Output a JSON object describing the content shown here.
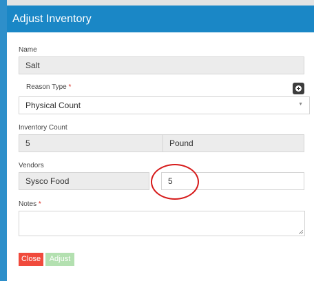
{
  "modal": {
    "title": "Adjust Inventory"
  },
  "form": {
    "name": {
      "label": "Name",
      "value": "Salt"
    },
    "reason_type": {
      "label": "Reason Type",
      "required_mark": "*",
      "selected": "Physical Count",
      "add_icon": "plus-circle-icon",
      "arrow_icon": "caret-down-icon"
    },
    "inventory_count": {
      "label": "Inventory Count",
      "value": "5",
      "unit": "Pound"
    },
    "vendors": {
      "label": "Vendors",
      "vendor_name": "Sysco Food",
      "quantity": "5"
    },
    "notes": {
      "label": "Notes",
      "required_mark": "*",
      "value": ""
    }
  },
  "buttons": {
    "close_label": "Close",
    "adjust_label": "Adjust"
  },
  "colors": {
    "header": "#1a87c6",
    "required": "#d9261c",
    "close_button": "#f04a3c",
    "adjust_button": "#b3e0b0",
    "annotation": "#d61a1a"
  }
}
